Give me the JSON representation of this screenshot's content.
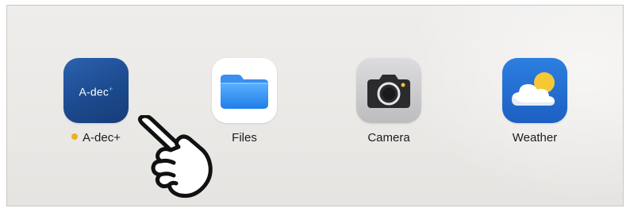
{
  "apps": [
    {
      "label": "A-dec+",
      "icon_text": "A-dec",
      "icon_sup": "+",
      "icon": "a-dec-app-icon",
      "badge_color": "#e8b323",
      "brand_color": "#1f4f98"
    },
    {
      "label": "Files",
      "icon": "files-folder-icon",
      "brand_color": "#2e8ef0"
    },
    {
      "label": "Camera",
      "icon": "camera-icon",
      "brand_color": "#b8b8bb"
    },
    {
      "label": "Weather",
      "icon": "weather-cloud-sun-icon",
      "brand_color": "#1f68d0"
    }
  ],
  "pointer": {
    "icon": "tap-hand-icon"
  }
}
